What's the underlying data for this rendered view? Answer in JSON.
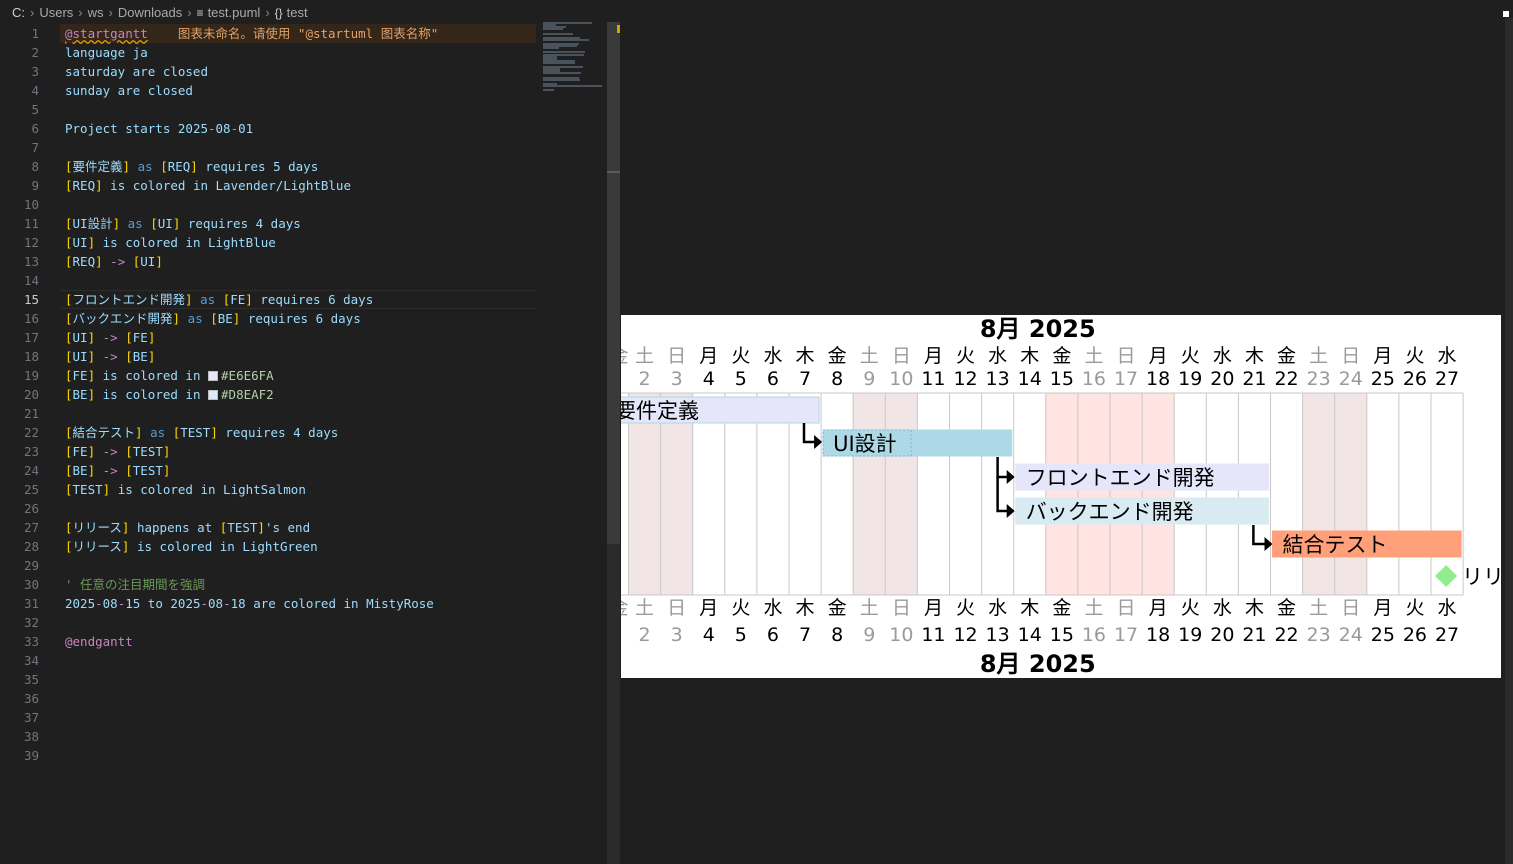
{
  "breadcrumb": [
    "C:",
    "Users",
    "ws",
    "Downloads",
    "test.puml",
    "test"
  ],
  "editor": {
    "active_line": 15,
    "inline_warning": "图表未命名。请使用 \"@startuml 图表名称\"",
    "lines": [
      [
        {
          "t": "@startgantt",
          "c": "kw",
          "u": true
        },
        {
          "t": "    ",
          "c": "plain"
        },
        {
          "t": "图表未命名。请使用 \"@startuml 图表名称\"",
          "c": "warn"
        }
      ],
      [
        {
          "t": "language ja",
          "c": "plain"
        }
      ],
      [
        {
          "t": "saturday are closed",
          "c": "plain"
        }
      ],
      [
        {
          "t": "sunday are closed",
          "c": "plain"
        }
      ],
      [],
      [
        {
          "t": "Project starts ",
          "c": "plain"
        },
        {
          "t": "2025",
          "c": "plain"
        },
        {
          "t": "-",
          "c": "kw"
        },
        {
          "t": "08",
          "c": "plain"
        },
        {
          "t": "-",
          "c": "kw"
        },
        {
          "t": "01",
          "c": "plain"
        }
      ],
      [],
      [
        {
          "t": "[",
          "c": "br"
        },
        {
          "t": "要件定義",
          "c": "plain"
        },
        {
          "t": "]",
          "c": "br"
        },
        {
          "t": " as ",
          "c": "blue"
        },
        {
          "t": "[",
          "c": "br"
        },
        {
          "t": "REQ",
          "c": "plain"
        },
        {
          "t": "]",
          "c": "br"
        },
        {
          "t": " requires 5 days",
          "c": "plain"
        }
      ],
      [
        {
          "t": "[",
          "c": "br"
        },
        {
          "t": "REQ",
          "c": "plain"
        },
        {
          "t": "]",
          "c": "br"
        },
        {
          "t": " is colored in Lavender/LightBlue",
          "c": "plain"
        }
      ],
      [],
      [
        {
          "t": "[",
          "c": "br"
        },
        {
          "t": "UI設計",
          "c": "plain"
        },
        {
          "t": "]",
          "c": "br"
        },
        {
          "t": " as ",
          "c": "blue"
        },
        {
          "t": "[",
          "c": "br"
        },
        {
          "t": "UI",
          "c": "plain"
        },
        {
          "t": "]",
          "c": "br"
        },
        {
          "t": " requires 4 days",
          "c": "plain"
        }
      ],
      [
        {
          "t": "[",
          "c": "br"
        },
        {
          "t": "UI",
          "c": "plain"
        },
        {
          "t": "]",
          "c": "br"
        },
        {
          "t": " is colored in LightBlue",
          "c": "plain"
        }
      ],
      [
        {
          "t": "[",
          "c": "br"
        },
        {
          "t": "REQ",
          "c": "plain"
        },
        {
          "t": "]",
          "c": "br"
        },
        {
          "t": " -> ",
          "c": "kw"
        },
        {
          "t": "[",
          "c": "br"
        },
        {
          "t": "UI",
          "c": "plain"
        },
        {
          "t": "]",
          "c": "br"
        }
      ],
      [],
      [
        {
          "t": "[",
          "c": "br"
        },
        {
          "t": "フロントエンド開発",
          "c": "plain"
        },
        {
          "t": "]",
          "c": "br"
        },
        {
          "t": " as ",
          "c": "blue"
        },
        {
          "t": "[",
          "c": "br"
        },
        {
          "t": "FE",
          "c": "plain"
        },
        {
          "t": "]",
          "c": "br"
        },
        {
          "t": " requires 6 days",
          "c": "plain"
        }
      ],
      [
        {
          "t": "[",
          "c": "br"
        },
        {
          "t": "バックエンド開発",
          "c": "plain"
        },
        {
          "t": "]",
          "c": "br"
        },
        {
          "t": " as ",
          "c": "blue"
        },
        {
          "t": "[",
          "c": "br"
        },
        {
          "t": "BE",
          "c": "plain"
        },
        {
          "t": "]",
          "c": "br"
        },
        {
          "t": " requires 6 days",
          "c": "plain"
        }
      ],
      [
        {
          "t": "[",
          "c": "br"
        },
        {
          "t": "UI",
          "c": "plain"
        },
        {
          "t": "]",
          "c": "br"
        },
        {
          "t": " -> ",
          "c": "kw"
        },
        {
          "t": "[",
          "c": "br"
        },
        {
          "t": "FE",
          "c": "plain"
        },
        {
          "t": "]",
          "c": "br"
        }
      ],
      [
        {
          "t": "[",
          "c": "br"
        },
        {
          "t": "UI",
          "c": "plain"
        },
        {
          "t": "]",
          "c": "br"
        },
        {
          "t": " -> ",
          "c": "kw"
        },
        {
          "t": "[",
          "c": "br"
        },
        {
          "t": "BE",
          "c": "plain"
        },
        {
          "t": "]",
          "c": "br"
        }
      ],
      [
        {
          "t": "[",
          "c": "br"
        },
        {
          "t": "FE",
          "c": "plain"
        },
        {
          "t": "]",
          "c": "br"
        },
        {
          "t": " is colored in ",
          "c": "plain"
        },
        {
          "sw": "#E6E6FA"
        },
        {
          "t": "#E6E6FA",
          "c": "num"
        }
      ],
      [
        {
          "t": "[",
          "c": "br"
        },
        {
          "t": "BE",
          "c": "plain"
        },
        {
          "t": "]",
          "c": "br"
        },
        {
          "t": " is colored in ",
          "c": "plain"
        },
        {
          "sw": "#D8EAF2"
        },
        {
          "t": "#D8EAF2",
          "c": "num"
        }
      ],
      [],
      [
        {
          "t": "[",
          "c": "br"
        },
        {
          "t": "結合テスト",
          "c": "plain"
        },
        {
          "t": "]",
          "c": "br"
        },
        {
          "t": " as ",
          "c": "blue"
        },
        {
          "t": "[",
          "c": "br"
        },
        {
          "t": "TEST",
          "c": "plain"
        },
        {
          "t": "]",
          "c": "br"
        },
        {
          "t": " requires 4 days",
          "c": "plain"
        }
      ],
      [
        {
          "t": "[",
          "c": "br"
        },
        {
          "t": "FE",
          "c": "plain"
        },
        {
          "t": "]",
          "c": "br"
        },
        {
          "t": " -> ",
          "c": "kw"
        },
        {
          "t": "[",
          "c": "br"
        },
        {
          "t": "TEST",
          "c": "plain"
        },
        {
          "t": "]",
          "c": "br"
        }
      ],
      [
        {
          "t": "[",
          "c": "br"
        },
        {
          "t": "BE",
          "c": "plain"
        },
        {
          "t": "]",
          "c": "br"
        },
        {
          "t": " -> ",
          "c": "kw"
        },
        {
          "t": "[",
          "c": "br"
        },
        {
          "t": "TEST",
          "c": "plain"
        },
        {
          "t": "]",
          "c": "br"
        }
      ],
      [
        {
          "t": "[",
          "c": "br"
        },
        {
          "t": "TEST",
          "c": "plain"
        },
        {
          "t": "]",
          "c": "br"
        },
        {
          "t": " is colored in LightSalmon",
          "c": "plain"
        }
      ],
      [],
      [
        {
          "t": "[",
          "c": "br"
        },
        {
          "t": "リリース",
          "c": "plain"
        },
        {
          "t": "]",
          "c": "br"
        },
        {
          "t": " happens at ",
          "c": "plain"
        },
        {
          "t": "[",
          "c": "br"
        },
        {
          "t": "TEST",
          "c": "plain"
        },
        {
          "t": "]",
          "c": "br"
        },
        {
          "t": "'s end",
          "c": "plain"
        }
      ],
      [
        {
          "t": "[",
          "c": "br"
        },
        {
          "t": "リリース",
          "c": "plain"
        },
        {
          "t": "]",
          "c": "br"
        },
        {
          "t": " is colored in LightGreen",
          "c": "plain"
        }
      ],
      [],
      [
        {
          "t": "' 任意の注目期間を強調",
          "c": "cmt"
        }
      ],
      [
        {
          "t": "2025",
          "c": "plain"
        },
        {
          "t": "-",
          "c": "kw"
        },
        {
          "t": "08",
          "c": "plain"
        },
        {
          "t": "-",
          "c": "kw"
        },
        {
          "t": "15 to 2025",
          "c": "plain"
        },
        {
          "t": "-",
          "c": "kw"
        },
        {
          "t": "08",
          "c": "plain"
        },
        {
          "t": "-",
          "c": "kw"
        },
        {
          "t": "18 are colored in MistyRose",
          "c": "plain"
        }
      ],
      [],
      [
        {
          "t": "@endgantt",
          "c": "kw"
        }
      ],
      [],
      [],
      [],
      [],
      [],
      []
    ]
  },
  "gantt": {
    "month_label": "8月 2025",
    "first_day": 2,
    "days": [
      {
        "d": "2",
        "w": "土",
        "off": true
      },
      {
        "d": "3",
        "w": "日",
        "off": true
      },
      {
        "d": "4",
        "w": "月"
      },
      {
        "d": "5",
        "w": "火"
      },
      {
        "d": "6",
        "w": "水"
      },
      {
        "d": "7",
        "w": "木"
      },
      {
        "d": "8",
        "w": "金"
      },
      {
        "d": "9",
        "w": "土",
        "off": true
      },
      {
        "d": "10",
        "w": "日",
        "off": true
      },
      {
        "d": "11",
        "w": "月"
      },
      {
        "d": "12",
        "w": "火"
      },
      {
        "d": "13",
        "w": "水"
      },
      {
        "d": "14",
        "w": "木"
      },
      {
        "d": "15",
        "w": "金",
        "rose": true
      },
      {
        "d": "16",
        "w": "土",
        "off": true,
        "rose": true
      },
      {
        "d": "17",
        "w": "日",
        "off": true,
        "rose": true
      },
      {
        "d": "18",
        "w": "月",
        "rose": true
      },
      {
        "d": "19",
        "w": "火"
      },
      {
        "d": "20",
        "w": "水"
      },
      {
        "d": "21",
        "w": "木"
      },
      {
        "d": "22",
        "w": "金"
      },
      {
        "d": "23",
        "w": "土",
        "off": true
      },
      {
        "d": "24",
        "w": "日",
        "off": true
      },
      {
        "d": "25",
        "w": "月"
      },
      {
        "d": "26",
        "w": "火"
      },
      {
        "d": "27",
        "w": "水"
      }
    ],
    "partial_left_weekday": "金",
    "tasks": [
      {
        "name": "要件定義",
        "start": 1,
        "end": 7,
        "color": "#E6E6FA",
        "border": "#ADD8E6"
      },
      {
        "name": "UI設計",
        "start": 8,
        "end": 13,
        "color": "#ADD8E6",
        "border": "#ADD8E6"
      },
      {
        "name": "フロントエンド開発",
        "start": 14,
        "end": 21,
        "color": "#E6E6FA",
        "border": "#E6E6FA"
      },
      {
        "name": "バックエンド開発",
        "start": 14,
        "end": 21,
        "color": "#D8EAF2",
        "border": "#D8EAF2"
      },
      {
        "name": "結合テスト",
        "start": 22,
        "end": 27,
        "color": "#FFA07A",
        "border": "#FFA07A"
      }
    ],
    "milestone": {
      "name": "リリース",
      "day": 27,
      "color": "#90EE90"
    },
    "shown_milestone_text": "リリ",
    "colors": {
      "closed": "#f1e5e5",
      "misty_rose": "#ffe4e1",
      "grid": "#c8c8c8",
      "off_text": "#9a9a9a"
    }
  }
}
